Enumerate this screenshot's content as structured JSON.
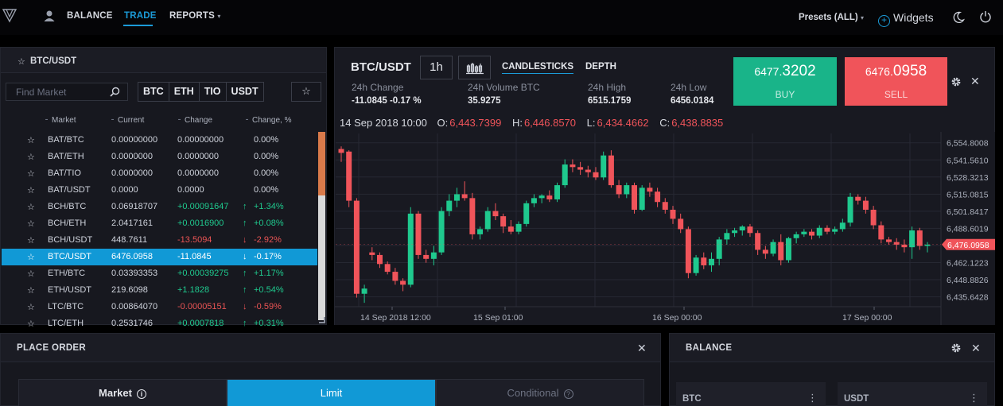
{
  "nav": {
    "balance": "BALANCE",
    "trade": "TRADE",
    "reports": "REPORTS",
    "reports_caret": "▾",
    "presets": "Presets (ALL)",
    "presets_caret": "▾",
    "widgets": "Widgets",
    "plus": "+",
    "accent": "#1b9bd8"
  },
  "markets": {
    "title": "BTC/USDT",
    "search_placeholder": "Find Market",
    "quote_buttons": [
      "BTC",
      "ETH",
      "TIO",
      "USDT"
    ],
    "fav": "☆",
    "star": "☆",
    "sort_dot": "⁃",
    "columns": {
      "market": "Market",
      "current": "Current",
      "change": "Change",
      "change_pct": "Change, %"
    },
    "rows": [
      {
        "star": "☆",
        "market": "BAT/BTC",
        "current": "0.00000000",
        "change": "0.00000000",
        "arrow": "",
        "pct": "0.00%",
        "dir": "none"
      },
      {
        "star": "☆",
        "market": "BAT/ETH",
        "current": "0.0000000",
        "change": "0.0000000",
        "arrow": "",
        "pct": "0.00%",
        "dir": "none"
      },
      {
        "star": "☆",
        "market": "BAT/TIO",
        "current": "0.0000000",
        "change": "0.0000000",
        "arrow": "",
        "pct": "0.00%",
        "dir": "none"
      },
      {
        "star": "☆",
        "market": "BAT/USDT",
        "current": "0.0000",
        "change": "0.0000",
        "arrow": "",
        "pct": "0.00%",
        "dir": "none"
      },
      {
        "star": "☆",
        "market": "BCH/BTC",
        "current": "0.06918707",
        "change": "+0.00091647",
        "arrow": "↑",
        "pct": "+1.34%",
        "dir": "up"
      },
      {
        "star": "☆",
        "market": "BCH/ETH",
        "current": "2.0417161",
        "change": "+0.0016900",
        "arrow": "↑",
        "pct": "+0.08%",
        "dir": "up"
      },
      {
        "star": "☆",
        "market": "BCH/USDT",
        "current": "448.7611",
        "change": "-13.5094",
        "arrow": "↓",
        "pct": "-2.92%",
        "dir": "down"
      },
      {
        "star": "☆",
        "market": "BTC/USDT",
        "current": "6476.0958",
        "change": "-11.0845",
        "arrow": "↓",
        "pct": "-0.17%",
        "dir": "down",
        "selected": true
      },
      {
        "star": "☆",
        "market": "ETH/BTC",
        "current": "0.03393353",
        "change": "+0.00039275",
        "arrow": "↑",
        "pct": "+1.17%",
        "dir": "up"
      },
      {
        "star": "☆",
        "market": "ETH/USDT",
        "current": "219.6098",
        "change": "+1.1828",
        "arrow": "↑",
        "pct": "+0.54%",
        "dir": "up"
      },
      {
        "star": "☆",
        "market": "LTC/BTC",
        "current": "0.00864070",
        "change": "-0.00005151",
        "arrow": "↓",
        "pct": "-0.59%",
        "dir": "down"
      },
      {
        "star": "☆",
        "market": "LTC/ETH",
        "current": "0.2531746",
        "change": "+0.0007818",
        "arrow": "↑",
        "pct": "+0.31%",
        "dir": "up"
      }
    ]
  },
  "chart_panel": {
    "pair": "BTC/USDT",
    "interval": "1h",
    "tab_candles": "CANDLESTICKS",
    "tab_depth": "DEPTH",
    "stats": [
      {
        "label": "24h Change",
        "value": "-11.0845 -0.17 %"
      },
      {
        "label": "24h Volume BTC",
        "value": "35.9275"
      },
      {
        "label": "24h High",
        "value": "6515.1759"
      },
      {
        "label": "24h Low",
        "value": "6456.0184"
      }
    ],
    "buy": {
      "price_main": "6477.",
      "price_frac": "3202",
      "label": "BUY",
      "color": "#19b489"
    },
    "sell": {
      "price_main": "6476.",
      "price_frac": "0958",
      "label": "SELL",
      "color": "#f0545a"
    },
    "close": "✕",
    "ohlc": {
      "date": "14 Sep 2018 10:00",
      "o_label": "O:",
      "o": "6,443.7399",
      "h_label": "H:",
      "h": "6,446.8570",
      "l_label": "L:",
      "l": "6,434.4662",
      "c_label": "C:",
      "c": "6,438.8835"
    }
  },
  "chart_data": {
    "type": "candlestick",
    "y_ticks": [
      "6,554.8008",
      "6,541.5610",
      "6,528.3213",
      "6,515.0815",
      "6,501.8417",
      "6,488.6019",
      "6,475.3621",
      "6,462.1223",
      "6,448.8826",
      "6,435.6428"
    ],
    "ylim": [
      6428,
      6562
    ],
    "x_ticks": [
      "14 Sep 2018 12:00",
      "15 Sep 01:00",
      "16 Sep 00:00",
      "17 Sep 00:00"
    ],
    "last_price_label": "6,476.0958",
    "up_color": "#1fc98e",
    "down_color": "#f0545a",
    "candles": [
      [
        6550,
        6552,
        6540,
        6547
      ],
      [
        6548,
        6549,
        6505,
        6510
      ],
      [
        6510,
        6512,
        6435,
        6438
      ],
      [
        6438,
        6445,
        6431,
        6442
      ],
      [
        6470,
        6474,
        6464,
        6468
      ],
      [
        6468,
        6470,
        6458,
        6461
      ],
      [
        6461,
        6463,
        6453,
        6455
      ],
      [
        6455,
        6458,
        6445,
        6448
      ],
      [
        6448,
        6450,
        6440,
        6445
      ],
      [
        6445,
        6505,
        6443,
        6500
      ],
      [
        6500,
        6502,
        6465,
        6468
      ],
      [
        6468,
        6472,
        6462,
        6465
      ],
      [
        6465,
        6475,
        6460,
        6470
      ],
      [
        6470,
        6505,
        6468,
        6502
      ],
      [
        6502,
        6515,
        6498,
        6510
      ],
      [
        6510,
        6520,
        6505,
        6515
      ],
      [
        6515,
        6525,
        6510,
        6512
      ],
      [
        6512,
        6516,
        6480,
        6484
      ],
      [
        6484,
        6490,
        6480,
        6488
      ],
      [
        6488,
        6505,
        6486,
        6502
      ],
      [
        6502,
        6508,
        6495,
        6498
      ],
      [
        6498,
        6500,
        6485,
        6490
      ],
      [
        6490,
        6495,
        6484,
        6486
      ],
      [
        6486,
        6494,
        6484,
        6492
      ],
      [
        6492,
        6510,
        6490,
        6508
      ],
      [
        6508,
        6515,
        6505,
        6512
      ],
      [
        6512,
        6515,
        6508,
        6514
      ],
      [
        6514,
        6518,
        6509,
        6511
      ],
      [
        6511,
        6524,
        6509,
        6522
      ],
      [
        6522,
        6542,
        6520,
        6538
      ],
      [
        6538,
        6542,
        6532,
        6536
      ],
      [
        6536,
        6540,
        6530,
        6534
      ],
      [
        6534,
        6537,
        6528,
        6532
      ],
      [
        6532,
        6536,
        6526,
        6528
      ],
      [
        6528,
        6548,
        6526,
        6545
      ],
      [
        6545,
        6549,
        6520,
        6522
      ],
      [
        6522,
        6526,
        6512,
        6515
      ],
      [
        6515,
        6524,
        6512,
        6522
      ],
      [
        6522,
        6524,
        6500,
        6503
      ],
      [
        6503,
        6522,
        6502,
        6520
      ],
      [
        6520,
        6524,
        6513,
        6517
      ],
      [
        6517,
        6520,
        6505,
        6509
      ],
      [
        6509,
        6512,
        6500,
        6503
      ],
      [
        6503,
        6506,
        6492,
        6496
      ],
      [
        6496,
        6500,
        6485,
        6488
      ],
      [
        6488,
        6490,
        6450,
        6454
      ],
      [
        6454,
        6468,
        6452,
        6466
      ],
      [
        6466,
        6470,
        6457,
        6460
      ],
      [
        6460,
        6470,
        6455,
        6465
      ],
      [
        6465,
        6482,
        6460,
        6480
      ],
      [
        6480,
        6488,
        6476,
        6485
      ],
      [
        6485,
        6489,
        6482,
        6487
      ],
      [
        6487,
        6491,
        6483,
        6490
      ],
      [
        6490,
        6492,
        6482,
        6485
      ],
      [
        6485,
        6487,
        6468,
        6472
      ],
      [
        6472,
        6475,
        6465,
        6469
      ],
      [
        6469,
        6480,
        6467,
        6478
      ],
      [
        6478,
        6484,
        6460,
        6464
      ],
      [
        6464,
        6482,
        6462,
        6481
      ],
      [
        6481,
        6486,
        6477,
        6484
      ],
      [
        6484,
        6488,
        6482,
        6486
      ],
      [
        6486,
        6488,
        6480,
        6483
      ],
      [
        6483,
        6491,
        6481,
        6489
      ],
      [
        6489,
        6491,
        6484,
        6486
      ],
      [
        6486,
        6490,
        6484,
        6488
      ],
      [
        6488,
        6496,
        6486,
        6493
      ],
      [
        6493,
        6516,
        6490,
        6513
      ],
      [
        6513,
        6515,
        6507,
        6510
      ],
      [
        6510,
        6513,
        6500,
        6503
      ],
      [
        6503,
        6506,
        6488,
        6491
      ],
      [
        6491,
        6494,
        6477,
        6480
      ],
      [
        6480,
        6482,
        6476,
        6478
      ],
      [
        6478,
        6481,
        6472,
        6476
      ],
      [
        6476,
        6480,
        6470,
        6474
      ],
      [
        6474,
        6490,
        6465,
        6487
      ],
      [
        6487,
        6489,
        6472,
        6475
      ],
      [
        6475,
        6478,
        6470,
        6476
      ]
    ]
  },
  "place_order": {
    "title": "PLACE ORDER",
    "close": "✕",
    "info": "i",
    "tabs": {
      "market": "Market",
      "limit": "Limit",
      "conditional": "Conditional"
    }
  },
  "balance": {
    "title": "BALANCE",
    "close": "✕",
    "cards": [
      {
        "label": "BTC",
        "menu": "⋮"
      },
      {
        "label": "USDT",
        "menu": "⋮"
      }
    ]
  }
}
